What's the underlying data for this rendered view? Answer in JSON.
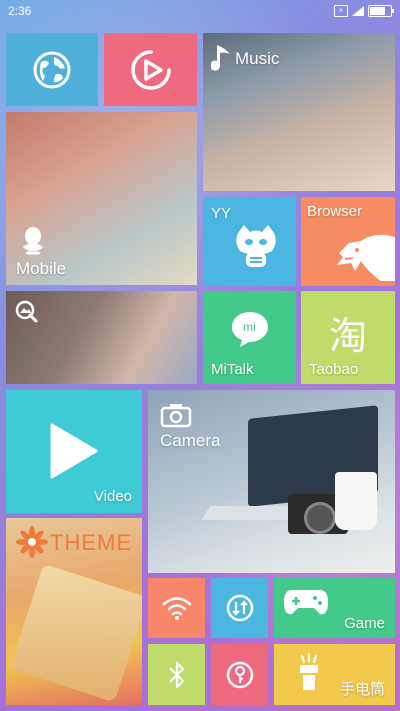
{
  "status": {
    "time": "2:36",
    "sim_icon": "x-box-icon"
  },
  "tiles": {
    "browser_globe": {
      "icon": "globe-icon",
      "color": "#4fb0dc"
    },
    "video_player": {
      "icon": "play-circle-icon",
      "color": "#f06a7f"
    },
    "music": {
      "label": "Music",
      "icon": "music-note-icon"
    },
    "mobile": {
      "label": "Mobile",
      "icon": "qq-penguin-icon"
    },
    "yy": {
      "label": "YY",
      "color": "#4cb6e2",
      "icon": "yy-mascot-icon"
    },
    "browser": {
      "label": "Browser",
      "color": "#f78c63",
      "icon": "cheetah-icon"
    },
    "gallery": {
      "icon": "gallery-search-icon"
    },
    "mitalk": {
      "label": "MiTalk",
      "badge": "mi",
      "color": "#43c989",
      "icon": "mi-bubble-icon"
    },
    "taobao": {
      "label": "Taobao",
      "glyph": "淘",
      "color": "#bfdc6a"
    },
    "video": {
      "label": "Video",
      "color": "#3fcbd5",
      "icon": "play-triangle-icon"
    },
    "camera": {
      "label": "Camera",
      "icon": "camera-icon"
    },
    "theme": {
      "label": "THEME",
      "icon": "flower-icon"
    },
    "wifi": {
      "color": "#f7866a",
      "icon": "wifi-icon"
    },
    "data_toggle": {
      "color": "#4cb6e2",
      "icon": "data-transfer-icon"
    },
    "game": {
      "label": "Game",
      "color": "#43c989",
      "icon": "gamepad-icon"
    },
    "bluetooth": {
      "color": "#bfdc6a",
      "icon": "bluetooth-icon"
    },
    "lock": {
      "color": "#f06a7f",
      "icon": "key-lock-icon"
    },
    "flashlight": {
      "label": "手电筒",
      "color": "#f2c94c",
      "icon": "flashlight-icon"
    }
  }
}
